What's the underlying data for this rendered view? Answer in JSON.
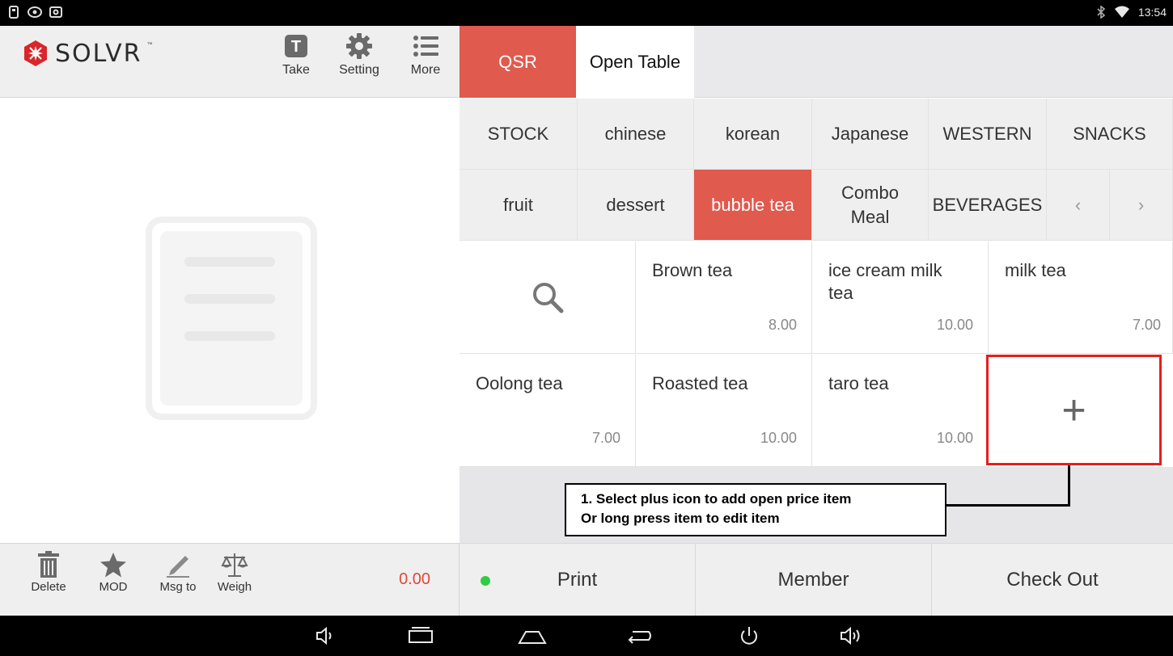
{
  "status_bar": {
    "time": "13:54",
    "left_icons": [
      "usb-icon",
      "eye-icon",
      "screenshot-icon"
    ],
    "right_icons": [
      "bluetooth-icon",
      "wifi-icon"
    ]
  },
  "brand": {
    "logo_text": "SOLVR",
    "trademark": "™"
  },
  "toolbar": {
    "take_label": "Take",
    "take_badge": "T",
    "setting_label": "Setting",
    "more_label": "More"
  },
  "order": {
    "total": "0.00"
  },
  "order_tools": {
    "delete_label": "Delete",
    "mod_label": "MOD",
    "msg_label": "Msg to",
    "weigh_label": "Weigh"
  },
  "mode_tabs": [
    {
      "label": "QSR",
      "active": true
    },
    {
      "label": "Open Table",
      "active": false
    }
  ],
  "categories": {
    "row1": [
      "STOCK",
      "chinese",
      "korean",
      "Japanese",
      "WESTERN",
      "SNACKS"
    ],
    "row2": [
      "fruit",
      "dessert",
      "bubble tea",
      "Combo Meal",
      "BEVERAGES"
    ],
    "active": "bubble tea",
    "prev_arrow": "‹",
    "next_arrow": "›"
  },
  "items": [
    {
      "name": "Brown tea",
      "price": "8.00"
    },
    {
      "name": "ice cream milk tea",
      "price": "10.00"
    },
    {
      "name": "milk tea",
      "price": "7.00"
    },
    {
      "name": "Oolong tea",
      "price": "7.00"
    },
    {
      "name": "Roasted tea",
      "price": "10.00"
    },
    {
      "name": "taro tea",
      "price": "10.00"
    }
  ],
  "add_item_symbol": "+",
  "callout": {
    "line1": "1. Select plus icon to add open price item",
    "line2": "Or long press item to edit item"
  },
  "actions": {
    "print_label": "Print",
    "member_label": "Member",
    "checkout_label": "Check Out"
  },
  "colors": {
    "accent": "#e05a4e",
    "total": "#e0473a",
    "print_dot": "#2ecc40",
    "highlight": "#e61e1e"
  }
}
